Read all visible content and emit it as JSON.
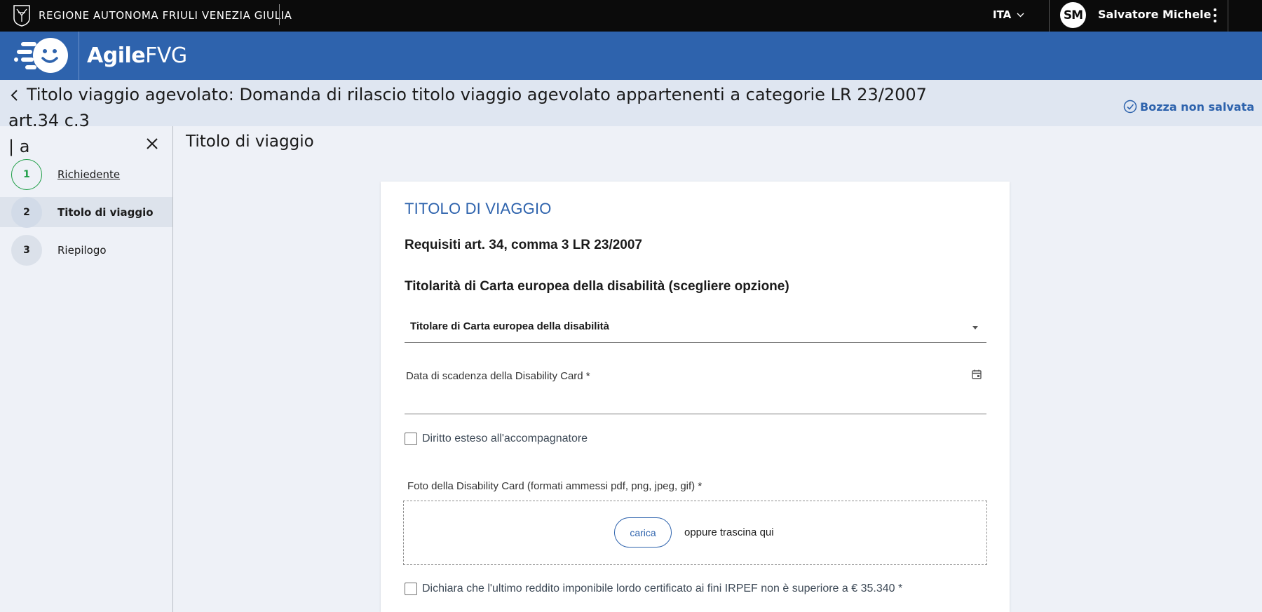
{
  "topbar": {
    "region": "REGIONE AUTONOMA FRIULI VENEZIA GIULIA",
    "language": "ITA",
    "avatar_initials": "SM",
    "user_name": "Salvatore Michele"
  },
  "appbar": {
    "brand_bold": "Agile",
    "brand_light": "FVG"
  },
  "page": {
    "title_line1": "Titolo viaggio agevolato: Domanda di rilascio titolo viaggio agevolato appartenenti a categorie LR 23/2007 art.34 c.3",
    "title_line2": "| a",
    "draft_status": "Bozza non salvata"
  },
  "sidebar": {
    "steps": [
      {
        "number": "1",
        "label": "Richiedente",
        "state": "completed"
      },
      {
        "number": "2",
        "label": "Titolo di viaggio",
        "state": "active"
      },
      {
        "number": "3",
        "label": "Riepilogo",
        "state": "pending"
      }
    ]
  },
  "main": {
    "section_title": "Titolo di viaggio",
    "card": {
      "title": "TITOLO DI VIAGGIO",
      "subtitle": "Requisiti art. 34, comma 3 LR 23/2007",
      "question": "Titolarità di Carta europea della disabilità (scegliere opzione)",
      "select_value": "Titolare di Carta europea della disabilità",
      "date_label": "Data di scadenza della Disability Card *",
      "date_value": "",
      "checkbox_companion": "Diritto esteso all'accompagnatore",
      "upload_label": "Foto della Disability Card (formati ammessi pdf, png, jpeg, gif) *",
      "upload_button": "carica",
      "upload_or": "oppure trascina qui",
      "checkbox_income": "Dichiara che l'ultimo reddito imponibile lordo certificato ai fini IRPEF non è superiore a € 35.340 *"
    }
  },
  "colors": {
    "brand_blue": "#2e63ad",
    "topbar_black": "#0b0b0b",
    "step_done_green": "#1e9e46",
    "page_bg": "#eef1f7"
  },
  "icons": [
    "crest-icon",
    "chevron-down-icon",
    "kebab-menu-icon",
    "agile-logo-icon",
    "back-chevron-icon",
    "check-circle-icon",
    "close-icon",
    "calendar-icon",
    "select-caret-icon"
  ]
}
